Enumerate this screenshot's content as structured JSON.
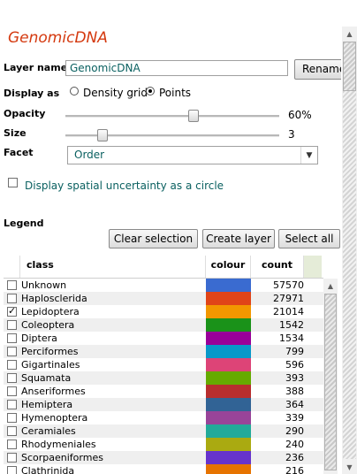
{
  "layer": {
    "title": "GenomicDNA",
    "name_label": "Layer name",
    "name_value": "GenomicDNA",
    "rename_label": "Rename"
  },
  "display": {
    "label": "Display as",
    "options": [
      "Density grid",
      "Points"
    ],
    "selected": "Points"
  },
  "opacity": {
    "label": "Opacity",
    "value_text": "60%",
    "value": 0.6
  },
  "size": {
    "label": "Size",
    "value_text": "3",
    "value": 3
  },
  "facet": {
    "label": "Facet",
    "selected": "Order"
  },
  "uncertainty": {
    "label": "Display spatial uncertainty as a circle",
    "checked": false
  },
  "legend": {
    "label": "Legend",
    "buttons": {
      "clear": "Clear selection",
      "create": "Create layer",
      "select_all": "Select all"
    },
    "columns": {
      "class": "class",
      "colour": "colour",
      "count": "count"
    },
    "rows": [
      {
        "class": "Unknown",
        "count": "57570",
        "color": "#3a6bd0",
        "checked": false
      },
      {
        "class": "Haplosclerida",
        "count": "27971",
        "color": "#e04418",
        "checked": false
      },
      {
        "class": "Lepidoptera",
        "count": "21014",
        "color": "#f29700",
        "checked": true
      },
      {
        "class": "Coleoptera",
        "count": "1542",
        "color": "#1a9219",
        "checked": false
      },
      {
        "class": "Diptera",
        "count": "1534",
        "color": "#990099",
        "checked": false
      },
      {
        "class": "Perciformes",
        "count": "799",
        "color": "#0898c9",
        "checked": false
      },
      {
        "class": "Gigartinales",
        "count": "596",
        "color": "#dd4477",
        "checked": false
      },
      {
        "class": "Squamata",
        "count": "393",
        "color": "#66aa00",
        "checked": false
      },
      {
        "class": "Anseriformes",
        "count": "388",
        "color": "#b82e2e",
        "checked": false
      },
      {
        "class": "Hemiptera",
        "count": "364",
        "color": "#316395",
        "checked": false
      },
      {
        "class": "Hymenoptera",
        "count": "339",
        "color": "#994499",
        "checked": false
      },
      {
        "class": "Ceramiales",
        "count": "290",
        "color": "#22aa99",
        "checked": false
      },
      {
        "class": "Rhodymeniales",
        "count": "240",
        "color": "#aaaa11",
        "checked": false
      },
      {
        "class": "Scorpaeniformes",
        "count": "236",
        "color": "#6633cc",
        "checked": false
      },
      {
        "class": "Clathrinida",
        "count": "216",
        "color": "#e67300",
        "checked": false
      }
    ]
  }
}
